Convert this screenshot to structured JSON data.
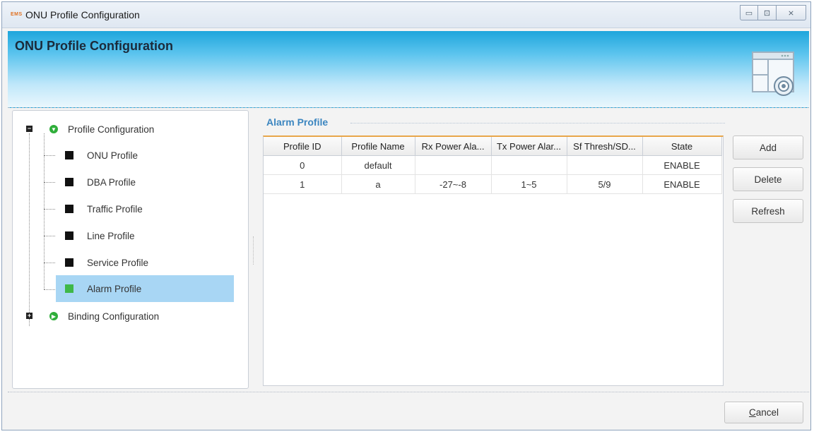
{
  "window": {
    "app_icon_text": "EMS",
    "title": "ONU Profile Configuration",
    "controls": {
      "minimize": "▭",
      "maximize": "⊡",
      "close": "⨯"
    }
  },
  "banner": {
    "title": "ONU Profile Configuration",
    "icon": "window-settings-icon"
  },
  "tree": {
    "root": {
      "label": "Profile Configuration",
      "expander": "−",
      "icon": "expanded-circle-icon"
    },
    "children": [
      {
        "label": "ONU Profile",
        "selected": false
      },
      {
        "label": "DBA Profile",
        "selected": false
      },
      {
        "label": "Traffic Profile",
        "selected": false
      },
      {
        "label": "Line Profile",
        "selected": false
      },
      {
        "label": "Service Profile",
        "selected": false
      },
      {
        "label": "Alarm Profile",
        "selected": true
      }
    ],
    "second_root": {
      "label": "Binding Configuration",
      "expander": "+",
      "icon": "collapsed-circle-icon"
    }
  },
  "section": {
    "title": "Alarm Profile"
  },
  "table": {
    "columns": [
      "Profile ID",
      "Profile Name",
      "Rx Power Ala...",
      "Tx Power Alar...",
      "Sf Thresh/SD...",
      "State"
    ],
    "rows": [
      [
        "0",
        "default",
        "",
        "",
        "",
        "ENABLE"
      ],
      [
        "1",
        "a",
        "-27~-8",
        "1~5",
        "5/9",
        "ENABLE"
      ]
    ]
  },
  "buttons": {
    "add": "Add",
    "delete": "Delete",
    "refresh": "Refresh"
  },
  "footer": {
    "cancel_first": "C",
    "cancel_rest": "ancel"
  },
  "colors": {
    "accent_title": "#3c86c0",
    "selection": "#a8d6f4",
    "tree_green": "#2fae3a",
    "table_top_border": "#e8a64a"
  }
}
